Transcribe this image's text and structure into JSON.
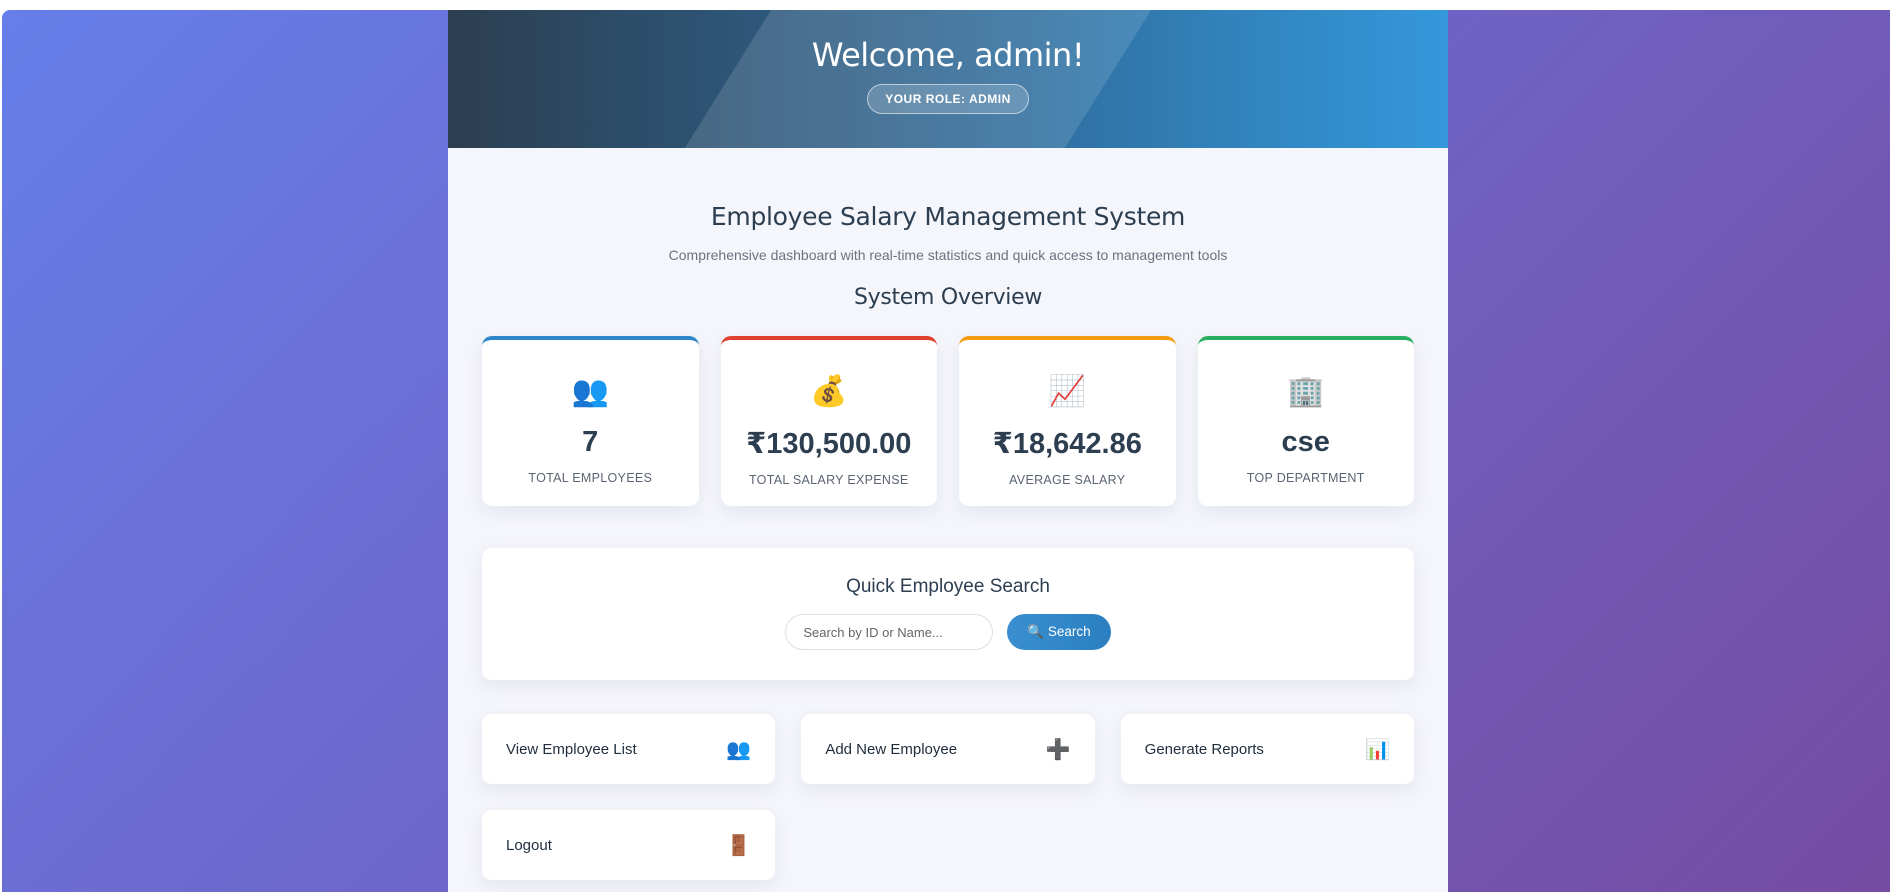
{
  "header": {
    "welcome": "Welcome, admin!",
    "role_badge": "YOUR ROLE: ADMIN"
  },
  "page": {
    "title": "Employee Salary Management System",
    "subtitle": "Comprehensive dashboard with real-time statistics and quick access to management tools",
    "overview_title": "System Overview"
  },
  "stats": [
    {
      "icon": "people-icon",
      "glyph": "👥",
      "value": "7",
      "label": "TOTAL EMPLOYEES",
      "accent": "#2e86c9"
    },
    {
      "icon": "money-bag-icon",
      "glyph": "💰",
      "value": "₹130,500.00",
      "label": "TOTAL SALARY EXPENSE",
      "accent": "#e0412f"
    },
    {
      "icon": "chart-increasing-icon",
      "glyph": "📈",
      "value": "₹18,642.86",
      "label": "AVERAGE SALARY",
      "accent": "#f39c12"
    },
    {
      "icon": "office-building-icon",
      "glyph": "🏢",
      "value": "cse",
      "label": "TOP DEPARTMENT",
      "accent": "#27ae60"
    }
  ],
  "search": {
    "title": "Quick Employee Search",
    "placeholder": "Search by ID or Name...",
    "button_label": "🔍 Search"
  },
  "actions": [
    {
      "label": "View Employee List",
      "icon": "people-icon",
      "glyph": "👥"
    },
    {
      "label": "Add New Employee",
      "icon": "plus-icon",
      "glyph": "➕"
    },
    {
      "label": "Generate Reports",
      "icon": "bar-chart-icon",
      "glyph": "📊"
    },
    {
      "label": "Logout",
      "icon": "door-icon",
      "glyph": "🚪"
    }
  ],
  "colors": {
    "background_gradient_start": "#667eea",
    "background_gradient_end": "#764ba2",
    "header_start": "#2c3e50",
    "header_end": "#3498db",
    "search_button": "#2a7fc0"
  }
}
